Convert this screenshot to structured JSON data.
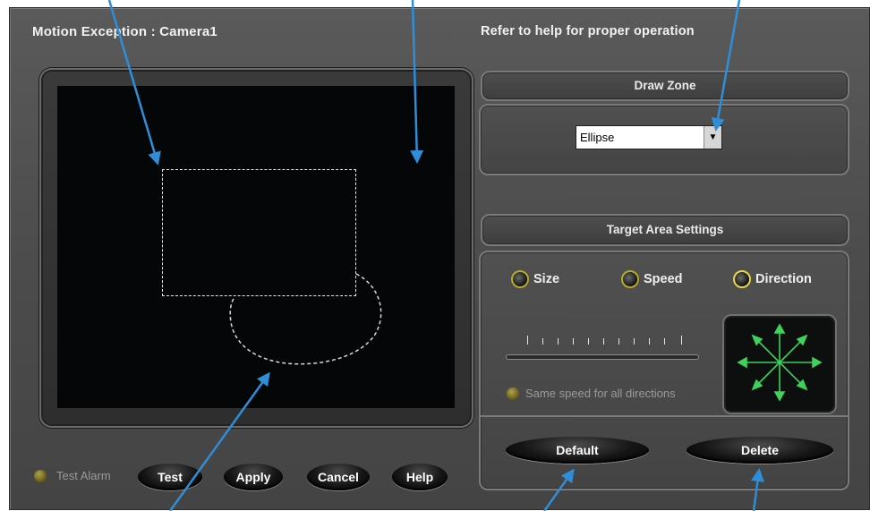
{
  "window": {
    "title": "Motion Exception : Camera1",
    "hint": "Refer to help for proper operation"
  },
  "draw_zone": {
    "header": "Draw Zone",
    "shape_value": "Ellipse"
  },
  "target_area": {
    "header": "Target Area Settings",
    "options": [
      "Size",
      "Speed",
      "Direction"
    ],
    "selected": "Direction",
    "same_speed_label": "Same speed for all directions",
    "default_label": "Default",
    "delete_label": "Delete"
  },
  "footer": {
    "test_alarm_label": "Test Alarm",
    "test_label": "Test",
    "apply_label": "Apply",
    "cancel_label": "Cancel",
    "help_label": "Help"
  },
  "colors": {
    "callout_arrow": "#2e8ed8",
    "direction_arrows": "#3fd15a",
    "radio_ring": "#d8c944"
  }
}
